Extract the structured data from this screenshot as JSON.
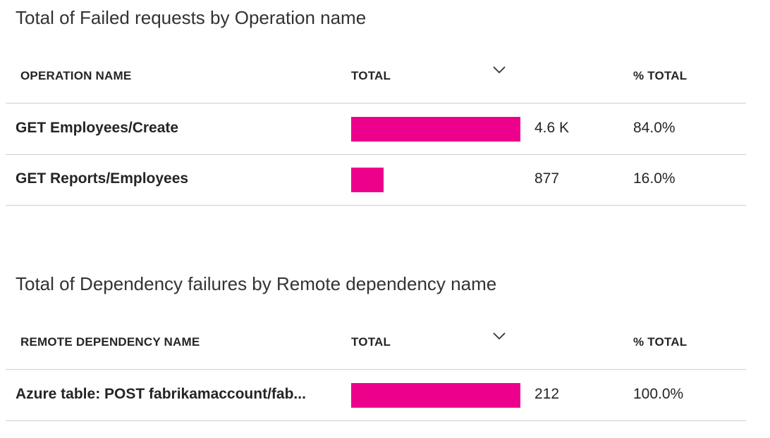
{
  "tables": [
    {
      "title": "Total of Failed requests by Operation name",
      "headers": {
        "name": "OPERATION NAME",
        "total": "TOTAL",
        "pct": "% TOTAL"
      },
      "sort_icon": "chevron-down-icon",
      "rows": [
        {
          "name": "GET Employees/Create",
          "value": "4.6 K",
          "pct": "84.0%",
          "bar_fraction": 1.0
        },
        {
          "name": "GET Reports/Employees",
          "value": "877",
          "pct": "16.0%",
          "bar_fraction": 0.19
        }
      ]
    },
    {
      "title": "Total of Dependency failures by Remote dependency name",
      "headers": {
        "name": "REMOTE DEPENDENCY NAME",
        "total": "TOTAL",
        "pct": "% TOTAL"
      },
      "sort_icon": "chevron-down-icon",
      "rows": [
        {
          "name": "Azure table: POST fabrikamaccount/fab...",
          "value": "212",
          "pct": "100.0%",
          "bar_fraction": 1.0
        }
      ]
    }
  ],
  "colors": {
    "bar": "#ec008c",
    "divider": "#cfcfcf",
    "text": "#252525"
  }
}
